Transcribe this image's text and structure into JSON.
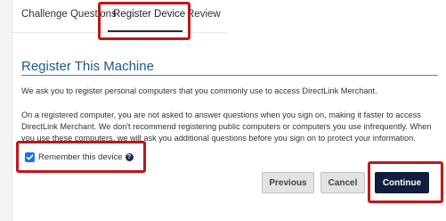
{
  "tabs": [
    {
      "label": "Challenge Questions"
    },
    {
      "label": "Register Device"
    },
    {
      "label": "Review"
    }
  ],
  "page_title": "Register This Machine",
  "paragraph_1": "We ask you to register personal computers that you commonly use to access DirectLink Merchant.",
  "paragraph_2": "On a registered computer, you are not asked to answer questions when you sign on, making it faster to access DirectLink Merchant. We don't recommend registering public computers or computers you use infrequently. When you use these computers, we will ask you additional questions before you sign on to protect your information.",
  "remember_checkbox": {
    "label": "Remember this device",
    "checked": true,
    "help_icon": "question-circle-icon"
  },
  "buttons": {
    "previous": "Previous",
    "cancel": "Cancel",
    "continue": "Continue"
  },
  "colors": {
    "highlight": "#c0161c",
    "primary": "#0f1f3d",
    "title": "#1b5a8a",
    "checkbox": "#1a73e8"
  }
}
